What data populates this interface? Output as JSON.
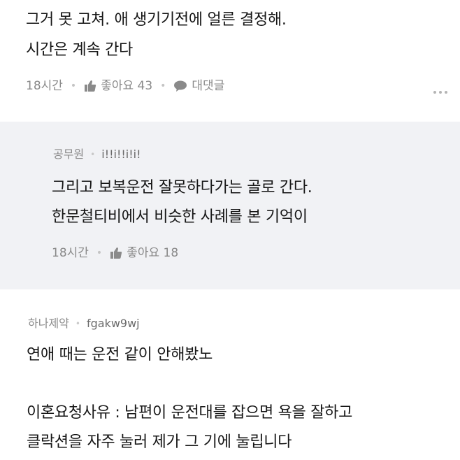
{
  "comment1": {
    "lines": [
      "그거 못 고쳐. 애 생기기전에 얼른 결정해.",
      "시간은 계속 간다"
    ],
    "time": "18시간",
    "like_label": "좋아요 43",
    "reply_label": "대댓글",
    "icons": {
      "like": "thumbs-up-icon",
      "reply": "speech-bubble-icon",
      "more": "more-dots-icon"
    }
  },
  "reply1": {
    "author": "공무원",
    "user_id": "i!!i!!i!i!",
    "lines": [
      "그리고 보복운전 잘못하다가는 골로 간다.",
      "한문철티비에서 비슷한 사례를 본 기억이"
    ],
    "time": "18시간",
    "like_label": "좋아요 18",
    "background": "#f1f2f5"
  },
  "comment2": {
    "author": "하나제약",
    "user_id": "fgakw9wj",
    "lines": [
      "연애 때는 운전 같이 안해봤노",
      "이혼요청사유 : 남편이 운전대를 잡으면 욕을 잘하고",
      "클락션을 자주 눌러 제가 그 기에 눌립니다"
    ]
  }
}
